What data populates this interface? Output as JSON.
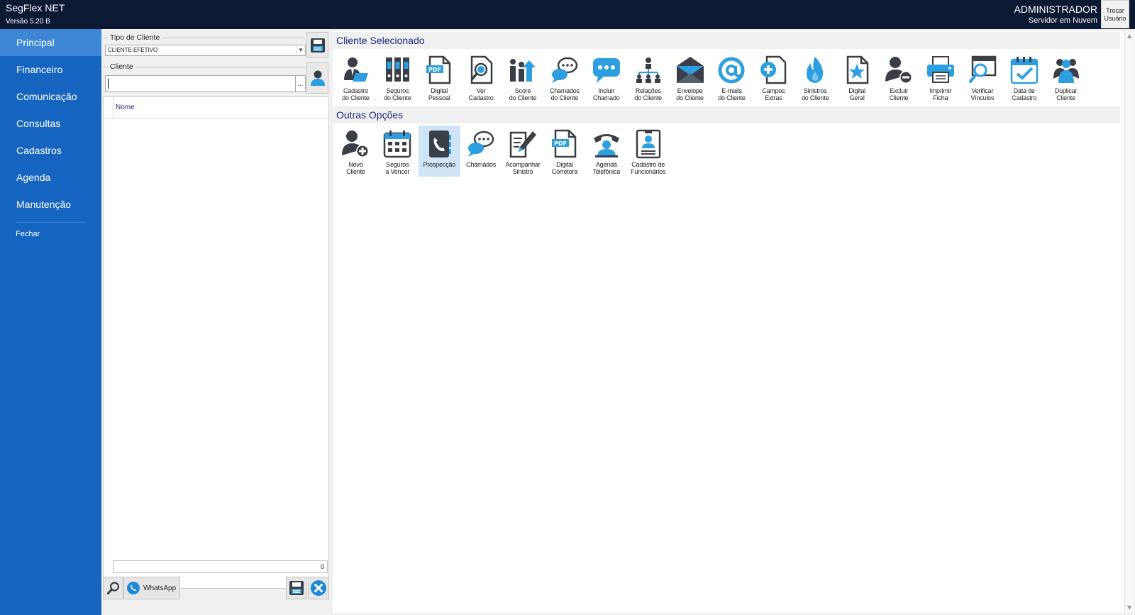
{
  "header": {
    "app_name": "SegFlex NET",
    "version": "Versão 5.20 B",
    "user": "ADMINISTRADOR",
    "server": "Servidor em Nuvem",
    "switch_user_line1": "Trocar",
    "switch_user_line2": "Usuário"
  },
  "sidebar": {
    "items": [
      {
        "label": "Principal"
      },
      {
        "label": "Financeiro"
      },
      {
        "label": "Comunicação"
      },
      {
        "label": "Consultas"
      },
      {
        "label": "Cadastros"
      },
      {
        "label": "Agenda"
      },
      {
        "label": "Manutenção"
      }
    ],
    "close_label": "Fechar"
  },
  "left_panel": {
    "client_type_legend": "Tipo de Cliente",
    "client_type_value": "CLIENTE EFETIVO",
    "client_legend": "Cliente",
    "client_value": "",
    "lookup_label": "...",
    "grid_column": "Nome",
    "record_count": "0",
    "whatsapp_label": "WhatsApp"
  },
  "sections": {
    "selected_client_title": "Cliente Selecionado",
    "other_options_title": "Outras Opções"
  },
  "client_tools": [
    {
      "label": "Cadastro\ndo Cliente",
      "icon": "client-profile-icon"
    },
    {
      "label": "Seguros\ndo Cliente",
      "icon": "binders-icon"
    },
    {
      "label": "Digital\nPessoal",
      "icon": "pdf-icon"
    },
    {
      "label": "Ver\nCadastro",
      "icon": "view-document-icon"
    },
    {
      "label": "Score\ndo Cliente",
      "icon": "score-icon"
    },
    {
      "label": "Chamados\ndo Cliente",
      "icon": "chat-bubbles-icon"
    },
    {
      "label": "Incluir\nChamado",
      "icon": "new-chat-icon"
    },
    {
      "label": "Relações\ndo Cliente",
      "icon": "org-chart-icon"
    },
    {
      "label": "Envelope\ndo Cliente",
      "icon": "envelope-icon"
    },
    {
      "label": "E-mails\ndo Cliente",
      "icon": "at-sign-icon"
    },
    {
      "label": "Campos\nExtras",
      "icon": "add-document-icon"
    },
    {
      "label": "Sinistros\ndo Cliente",
      "icon": "fire-icon"
    },
    {
      "label": "Digital\nGeral",
      "icon": "star-document-icon"
    },
    {
      "label": "Excluir\nCliente",
      "icon": "remove-user-icon"
    },
    {
      "label": "Imprimir\nFicha",
      "icon": "printer-icon"
    },
    {
      "label": "Verificar\nVínculos",
      "icon": "search-window-icon"
    },
    {
      "label": "Data de\nCadastro",
      "icon": "calendar-check-icon"
    },
    {
      "label": "Duplicar\nCliente",
      "icon": "duplicate-user-icon"
    }
  ],
  "other_tools": [
    {
      "label": "Novo\nCliente",
      "icon": "add-user-icon"
    },
    {
      "label": "Seguros\na Vencer",
      "icon": "calendar-grid-icon"
    },
    {
      "label": "Prospecção",
      "icon": "phone-book-icon"
    },
    {
      "label": "Chamados",
      "icon": "chat-bubbles-icon"
    },
    {
      "label": "Acompanhar\nSinistro",
      "icon": "edit-document-icon"
    },
    {
      "label": "Digital\nCorretora",
      "icon": "pdf-icon"
    },
    {
      "label": "Agenda\nTelefônica",
      "icon": "phone-contact-icon"
    },
    {
      "label": "Cadastro de\nFuncionários",
      "icon": "id-card-icon"
    }
  ],
  "colors": {
    "topbar": "#0b1932",
    "sidebar": "#1565c0",
    "sidebar_active": "#3d87d6",
    "icon_dark": "#3a3f47",
    "icon_blue": "#2d9fe0",
    "selected_tool": "#cfe4f7"
  }
}
